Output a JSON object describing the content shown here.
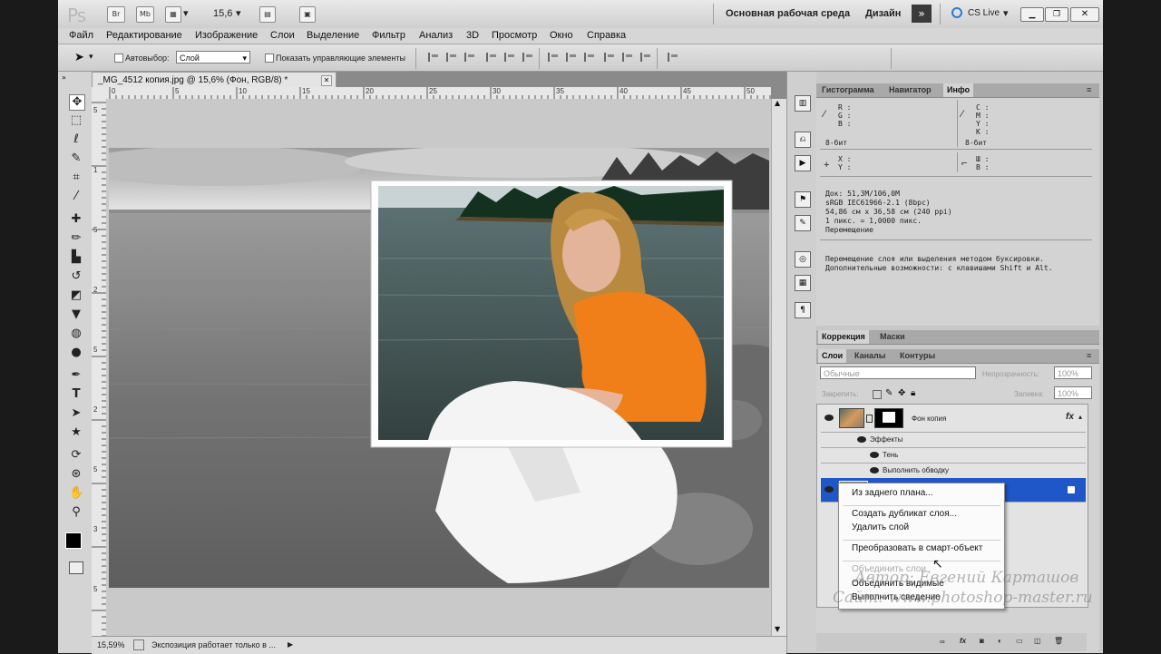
{
  "appbar": {
    "logo": "Ps",
    "icons": [
      "Br",
      "Mb"
    ],
    "zoom": "15,6",
    "workspace": "Основная рабочая среда",
    "design": "Дизайн",
    "cslive": "CS Live"
  },
  "menu": [
    "Файл",
    "Редактирование",
    "Изображение",
    "Слои",
    "Выделение",
    "Фильтр",
    "Анализ",
    "3D",
    "Просмотр",
    "Окно",
    "Справка"
  ],
  "options": {
    "autoselect": "Автовыбор:",
    "layer_select": "Слой",
    "show_controls": "Показать управляющие элементы"
  },
  "document": {
    "tab": "_MG_4512 копия.jpg @ 15,6% (Фон, RGB/8) *",
    "ruler_h": [
      "0",
      "5",
      "10",
      "15",
      "20",
      "25",
      "30",
      "35",
      "40",
      "45",
      "50"
    ],
    "ruler_v": [
      "5",
      "1",
      "5",
      "2",
      "5",
      "2",
      "5",
      "3",
      "5"
    ],
    "zoom": "15,59%",
    "status": "Экспозиция работает только в ..."
  },
  "panels": {
    "top_tabs": [
      "Гистограмма",
      "Навигатор",
      "Инфо"
    ],
    "info": {
      "rgb": [
        "R :",
        "G :",
        "B :"
      ],
      "cmyk": [
        "C :",
        "M :",
        "Y :",
        "K :"
      ],
      "bits1": "8-бит",
      "bits2": "8-бит",
      "xy": [
        "X :",
        "Y :"
      ],
      "wh": [
        "Ш :",
        "В :"
      ],
      "doc_lines": [
        "Док: 51,3M/106,0M",
        "sRGB IEC61966-2.1 (8bpc)",
        "54,86 см x 36,58 см (240 ppi)",
        "1 пикс. = 1,0000 пикс.",
        "Перемещение"
      ],
      "hint1": "Перемещение слоя или выделения методом буксировки.",
      "hint2": "Дополнительные возможности: с клавишами Shift и Alt."
    },
    "mid_tabs": [
      "Коррекция",
      "Маски"
    ],
    "layers_tabs": [
      "Слои",
      "Каналы",
      "Контуры"
    ],
    "blend": "Обычные",
    "opacity_label": "Непрозрачность:",
    "opacity": "100%",
    "lock_label": "Закрепить:",
    "fill_label": "Заливка:",
    "fill": "100%",
    "layers": [
      {
        "name": "Фон копия",
        "fx": "fx"
      },
      {
        "name": "Эффекты"
      },
      {
        "name": "Тень"
      },
      {
        "name": "Выполнить обводку"
      }
    ]
  },
  "context_menu": {
    "items": [
      {
        "label": "Из заднего плана...",
        "enabled": true
      },
      {
        "label": "Создать дубликат слоя...",
        "enabled": true
      },
      {
        "label": "Удалить слой",
        "enabled": true
      },
      {
        "label": "Преобразовать в смарт-объект",
        "enabled": true
      },
      {
        "label": "Объединить слои",
        "enabled": false
      },
      {
        "label": "Объединить видимые",
        "enabled": true
      },
      {
        "label": "Выполнить сведение",
        "enabled": true
      }
    ]
  },
  "watermark": {
    "line1": "Автор: Евгений Карташов",
    "line2": "Сайт: www.photoshop-master.ru"
  },
  "colors": {
    "orange": "#f07f1a",
    "selected_layer": "#1f57c8"
  }
}
